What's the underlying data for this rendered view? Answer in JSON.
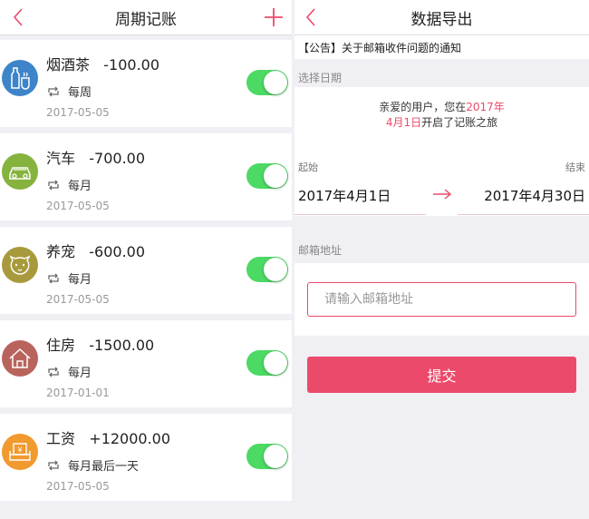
{
  "left": {
    "title": "周期记账",
    "items": [
      {
        "name": "烟酒茶",
        "amount": "-100.00",
        "repeat": "每周",
        "date": "2017-05-05",
        "icon": "bottle-cup-icon",
        "color": "#3d84c8",
        "enabled": true
      },
      {
        "name": "汽车",
        "amount": "-700.00",
        "repeat": "每月",
        "date": "2017-05-05",
        "icon": "car-icon",
        "color": "#86b33d",
        "enabled": true
      },
      {
        "name": "养宠",
        "amount": "-600.00",
        "repeat": "每月",
        "date": "2017-05-05",
        "icon": "pet-face-icon",
        "color": "#a89a3c",
        "enabled": true
      },
      {
        "name": "住房",
        "amount": "-1500.00",
        "repeat": "每月",
        "date": "2017-01-01",
        "icon": "house-icon",
        "color": "#b8645d",
        "enabled": true
      },
      {
        "name": "工资",
        "amount": "+12000.00",
        "repeat": "每月最后一天",
        "date": "2017-05-05",
        "icon": "salary-icon",
        "color": "#f09a2f",
        "enabled": true
      }
    ]
  },
  "right": {
    "title": "数据导出",
    "notice": "【公告】关于邮箱收件问题的通知",
    "date_section": "选择日期",
    "greeting_pre": "亲爱的用户，您在",
    "greeting_hl1": "2017年",
    "greeting_hl2": "4月1日",
    "greeting_post": "开启了记账之旅",
    "start_label": "起始",
    "end_label": "结束",
    "start_date": "2017年4月1日",
    "end_date": "2017年4月30日",
    "email_section": "邮箱地址",
    "email_placeholder": "请输入邮箱地址",
    "email_value": "",
    "submit_label": "提交"
  },
  "colors": {
    "accent": "#ec4a6a",
    "toggle_on": "#4cd964"
  }
}
